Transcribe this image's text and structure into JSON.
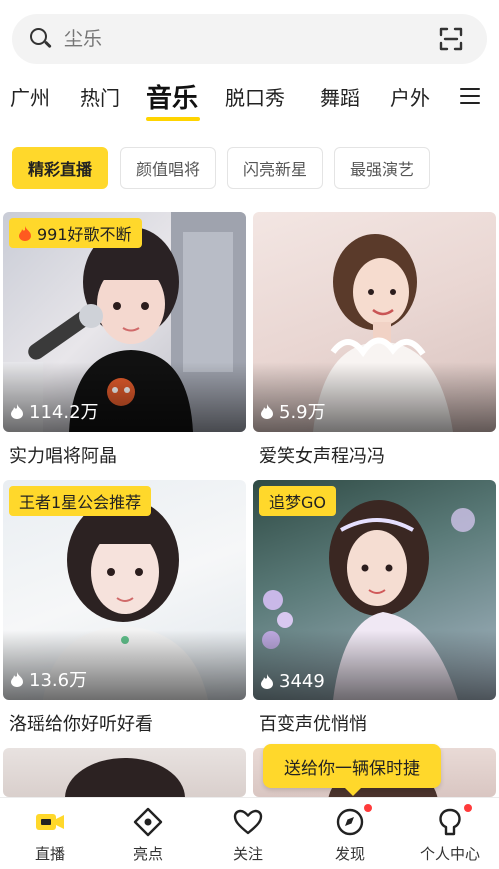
{
  "search": {
    "placeholder": "尘乐"
  },
  "tabs": [
    {
      "label": "广州",
      "active": false
    },
    {
      "label": "热门",
      "active": false
    },
    {
      "label": "音乐",
      "active": true
    },
    {
      "label": "脱口秀",
      "active": false
    },
    {
      "label": "舞蹈",
      "active": false
    },
    {
      "label": "户外",
      "active": false
    }
  ],
  "filters": [
    {
      "label": "精彩直播",
      "active": true
    },
    {
      "label": "颜值唱将",
      "active": false
    },
    {
      "label": "闪亮新星",
      "active": false
    },
    {
      "label": "最强演艺",
      "active": false
    }
  ],
  "cards": [
    {
      "title": "实力唱将阿晶",
      "viewers": "114.2万",
      "badge": "991好歌不断",
      "badge_icon": "fire-icon"
    },
    {
      "title": "爱笑女声程冯冯",
      "viewers": "5.9万",
      "badge": ""
    },
    {
      "title": "洛瑶给你好听好看",
      "viewers": "13.6万",
      "badge": "王者1星公会推荐"
    },
    {
      "title": "百变声优悄悄",
      "viewers": "3449",
      "badge": "追梦GO"
    }
  ],
  "tooltip": {
    "text": "送给你一辆保时捷"
  },
  "bottom_nav": [
    {
      "label": "直播",
      "icon": "video-camera-icon",
      "active": true,
      "dot": false
    },
    {
      "label": "亮点",
      "icon": "eye-icon",
      "active": false,
      "dot": false
    },
    {
      "label": "关注",
      "icon": "heart-icon",
      "active": false,
      "dot": false
    },
    {
      "label": "发现",
      "icon": "compass-icon",
      "active": false,
      "dot": true
    },
    {
      "label": "个人中心",
      "icon": "profile-icon",
      "active": false,
      "dot": true
    }
  ],
  "colors": {
    "accent": "#ffd82b",
    "text": "#222222",
    "badge_dot": "#ff3b3b"
  }
}
